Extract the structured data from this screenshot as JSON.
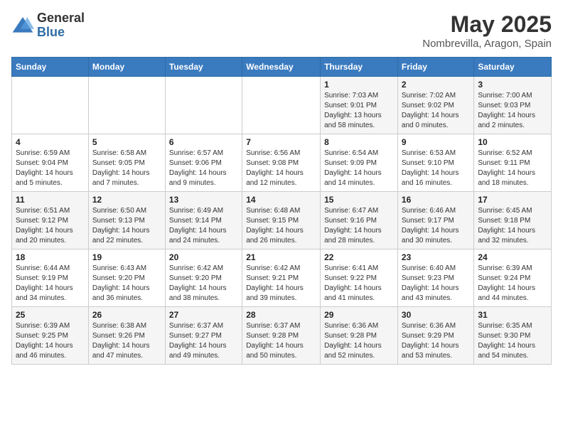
{
  "logo": {
    "general": "General",
    "blue": "Blue"
  },
  "title": "May 2025",
  "subtitle": "Nombrevilla, Aragon, Spain",
  "headers": [
    "Sunday",
    "Monday",
    "Tuesday",
    "Wednesday",
    "Thursday",
    "Friday",
    "Saturday"
  ],
  "weeks": [
    [
      {
        "day": "",
        "sunrise": "",
        "sunset": "",
        "daylight": ""
      },
      {
        "day": "",
        "sunrise": "",
        "sunset": "",
        "daylight": ""
      },
      {
        "day": "",
        "sunrise": "",
        "sunset": "",
        "daylight": ""
      },
      {
        "day": "",
        "sunrise": "",
        "sunset": "",
        "daylight": ""
      },
      {
        "day": "1",
        "sunrise": "Sunrise: 7:03 AM",
        "sunset": "Sunset: 9:01 PM",
        "daylight": "Daylight: 13 hours and 58 minutes."
      },
      {
        "day": "2",
        "sunrise": "Sunrise: 7:02 AM",
        "sunset": "Sunset: 9:02 PM",
        "daylight": "Daylight: 14 hours and 0 minutes."
      },
      {
        "day": "3",
        "sunrise": "Sunrise: 7:00 AM",
        "sunset": "Sunset: 9:03 PM",
        "daylight": "Daylight: 14 hours and 2 minutes."
      }
    ],
    [
      {
        "day": "4",
        "sunrise": "Sunrise: 6:59 AM",
        "sunset": "Sunset: 9:04 PM",
        "daylight": "Daylight: 14 hours and 5 minutes."
      },
      {
        "day": "5",
        "sunrise": "Sunrise: 6:58 AM",
        "sunset": "Sunset: 9:05 PM",
        "daylight": "Daylight: 14 hours and 7 minutes."
      },
      {
        "day": "6",
        "sunrise": "Sunrise: 6:57 AM",
        "sunset": "Sunset: 9:06 PM",
        "daylight": "Daylight: 14 hours and 9 minutes."
      },
      {
        "day": "7",
        "sunrise": "Sunrise: 6:56 AM",
        "sunset": "Sunset: 9:08 PM",
        "daylight": "Daylight: 14 hours and 12 minutes."
      },
      {
        "day": "8",
        "sunrise": "Sunrise: 6:54 AM",
        "sunset": "Sunset: 9:09 PM",
        "daylight": "Daylight: 14 hours and 14 minutes."
      },
      {
        "day": "9",
        "sunrise": "Sunrise: 6:53 AM",
        "sunset": "Sunset: 9:10 PM",
        "daylight": "Daylight: 14 hours and 16 minutes."
      },
      {
        "day": "10",
        "sunrise": "Sunrise: 6:52 AM",
        "sunset": "Sunset: 9:11 PM",
        "daylight": "Daylight: 14 hours and 18 minutes."
      }
    ],
    [
      {
        "day": "11",
        "sunrise": "Sunrise: 6:51 AM",
        "sunset": "Sunset: 9:12 PM",
        "daylight": "Daylight: 14 hours and 20 minutes."
      },
      {
        "day": "12",
        "sunrise": "Sunrise: 6:50 AM",
        "sunset": "Sunset: 9:13 PM",
        "daylight": "Daylight: 14 hours and 22 minutes."
      },
      {
        "day": "13",
        "sunrise": "Sunrise: 6:49 AM",
        "sunset": "Sunset: 9:14 PM",
        "daylight": "Daylight: 14 hours and 24 minutes."
      },
      {
        "day": "14",
        "sunrise": "Sunrise: 6:48 AM",
        "sunset": "Sunset: 9:15 PM",
        "daylight": "Daylight: 14 hours and 26 minutes."
      },
      {
        "day": "15",
        "sunrise": "Sunrise: 6:47 AM",
        "sunset": "Sunset: 9:16 PM",
        "daylight": "Daylight: 14 hours and 28 minutes."
      },
      {
        "day": "16",
        "sunrise": "Sunrise: 6:46 AM",
        "sunset": "Sunset: 9:17 PM",
        "daylight": "Daylight: 14 hours and 30 minutes."
      },
      {
        "day": "17",
        "sunrise": "Sunrise: 6:45 AM",
        "sunset": "Sunset: 9:18 PM",
        "daylight": "Daylight: 14 hours and 32 minutes."
      }
    ],
    [
      {
        "day": "18",
        "sunrise": "Sunrise: 6:44 AM",
        "sunset": "Sunset: 9:19 PM",
        "daylight": "Daylight: 14 hours and 34 minutes."
      },
      {
        "day": "19",
        "sunrise": "Sunrise: 6:43 AM",
        "sunset": "Sunset: 9:20 PM",
        "daylight": "Daylight: 14 hours and 36 minutes."
      },
      {
        "day": "20",
        "sunrise": "Sunrise: 6:42 AM",
        "sunset": "Sunset: 9:20 PM",
        "daylight": "Daylight: 14 hours and 38 minutes."
      },
      {
        "day": "21",
        "sunrise": "Sunrise: 6:42 AM",
        "sunset": "Sunset: 9:21 PM",
        "daylight": "Daylight: 14 hours and 39 minutes."
      },
      {
        "day": "22",
        "sunrise": "Sunrise: 6:41 AM",
        "sunset": "Sunset: 9:22 PM",
        "daylight": "Daylight: 14 hours and 41 minutes."
      },
      {
        "day": "23",
        "sunrise": "Sunrise: 6:40 AM",
        "sunset": "Sunset: 9:23 PM",
        "daylight": "Daylight: 14 hours and 43 minutes."
      },
      {
        "day": "24",
        "sunrise": "Sunrise: 6:39 AM",
        "sunset": "Sunset: 9:24 PM",
        "daylight": "Daylight: 14 hours and 44 minutes."
      }
    ],
    [
      {
        "day": "25",
        "sunrise": "Sunrise: 6:39 AM",
        "sunset": "Sunset: 9:25 PM",
        "daylight": "Daylight: 14 hours and 46 minutes."
      },
      {
        "day": "26",
        "sunrise": "Sunrise: 6:38 AM",
        "sunset": "Sunset: 9:26 PM",
        "daylight": "Daylight: 14 hours and 47 minutes."
      },
      {
        "day": "27",
        "sunrise": "Sunrise: 6:37 AM",
        "sunset": "Sunset: 9:27 PM",
        "daylight": "Daylight: 14 hours and 49 minutes."
      },
      {
        "day": "28",
        "sunrise": "Sunrise: 6:37 AM",
        "sunset": "Sunset: 9:28 PM",
        "daylight": "Daylight: 14 hours and 50 minutes."
      },
      {
        "day": "29",
        "sunrise": "Sunrise: 6:36 AM",
        "sunset": "Sunset: 9:28 PM",
        "daylight": "Daylight: 14 hours and 52 minutes."
      },
      {
        "day": "30",
        "sunrise": "Sunrise: 6:36 AM",
        "sunset": "Sunset: 9:29 PM",
        "daylight": "Daylight: 14 hours and 53 minutes."
      },
      {
        "day": "31",
        "sunrise": "Sunrise: 6:35 AM",
        "sunset": "Sunset: 9:30 PM",
        "daylight": "Daylight: 14 hours and 54 minutes."
      }
    ]
  ]
}
